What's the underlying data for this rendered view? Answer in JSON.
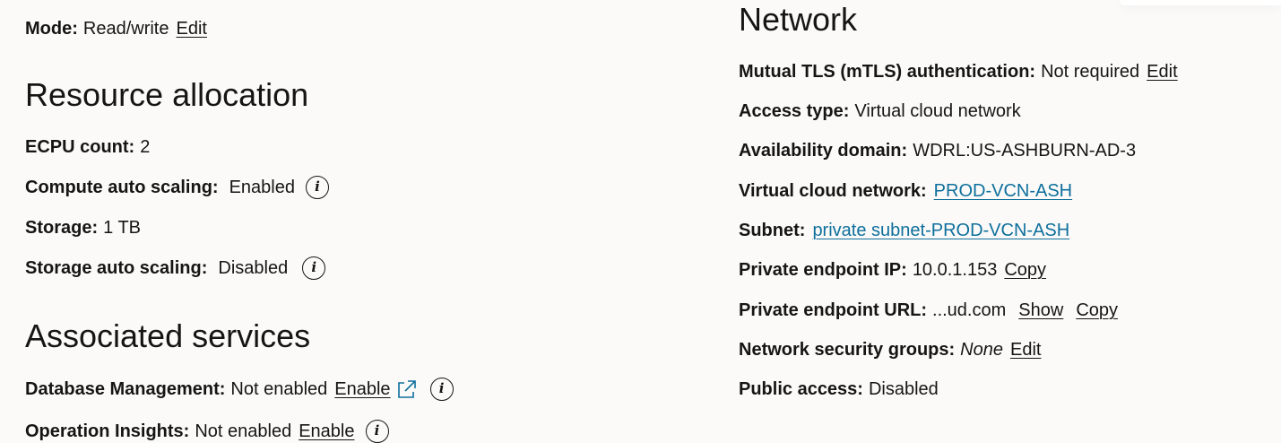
{
  "mode": {
    "label": "Mode:",
    "value": "Read/write",
    "edit": "Edit"
  },
  "resource": {
    "heading": "Resource allocation",
    "ecpu": {
      "label": "ECPU count:",
      "value": "2"
    },
    "compute_scaling": {
      "label": "Compute auto scaling:",
      "value": "Enabled",
      "info_glyph": "i"
    },
    "storage": {
      "label": "Storage:",
      "value": "1 TB"
    },
    "storage_scaling": {
      "label": "Storage auto scaling:",
      "value": "Disabled",
      "info_glyph": "i"
    }
  },
  "services": {
    "heading": "Associated services",
    "db_mgmt": {
      "label": "Database Management:",
      "value": "Not enabled",
      "link": "Enable",
      "icon": "external-link-icon",
      "info_glyph": "i"
    },
    "ops_insights": {
      "label": "Operation Insights:",
      "value": "Not enabled",
      "link": "Enable",
      "info_glyph": "i"
    }
  },
  "network": {
    "heading": "Network",
    "mtls": {
      "label": "Mutual TLS (mTLS) authentication:",
      "value": "Not required",
      "edit": "Edit"
    },
    "access_type": {
      "label": "Access type:",
      "value": "Virtual cloud network"
    },
    "availability_domain": {
      "label": "Availability domain:",
      "value": "WDRL:US-ASHBURN-AD-3"
    },
    "vcn": {
      "label": "Virtual cloud network:",
      "link": "PROD-VCN-ASH"
    },
    "subnet": {
      "label": "Subnet:",
      "link": "private subnet-PROD-VCN-ASH"
    },
    "private_ip": {
      "label": "Private endpoint IP:",
      "value": "10.0.1.153",
      "copy": "Copy"
    },
    "private_url": {
      "label": "Private endpoint URL:",
      "value": "...ud.com",
      "show": "Show",
      "copy": "Copy"
    },
    "nsg": {
      "label": "Network security groups:",
      "value": "None",
      "edit": "Edit"
    },
    "public_access": {
      "label": "Public access:",
      "value": "Disabled"
    }
  },
  "colors": {
    "link_blue": "#0e6f9c",
    "text": "#161513",
    "background": "#fbfaf9"
  }
}
